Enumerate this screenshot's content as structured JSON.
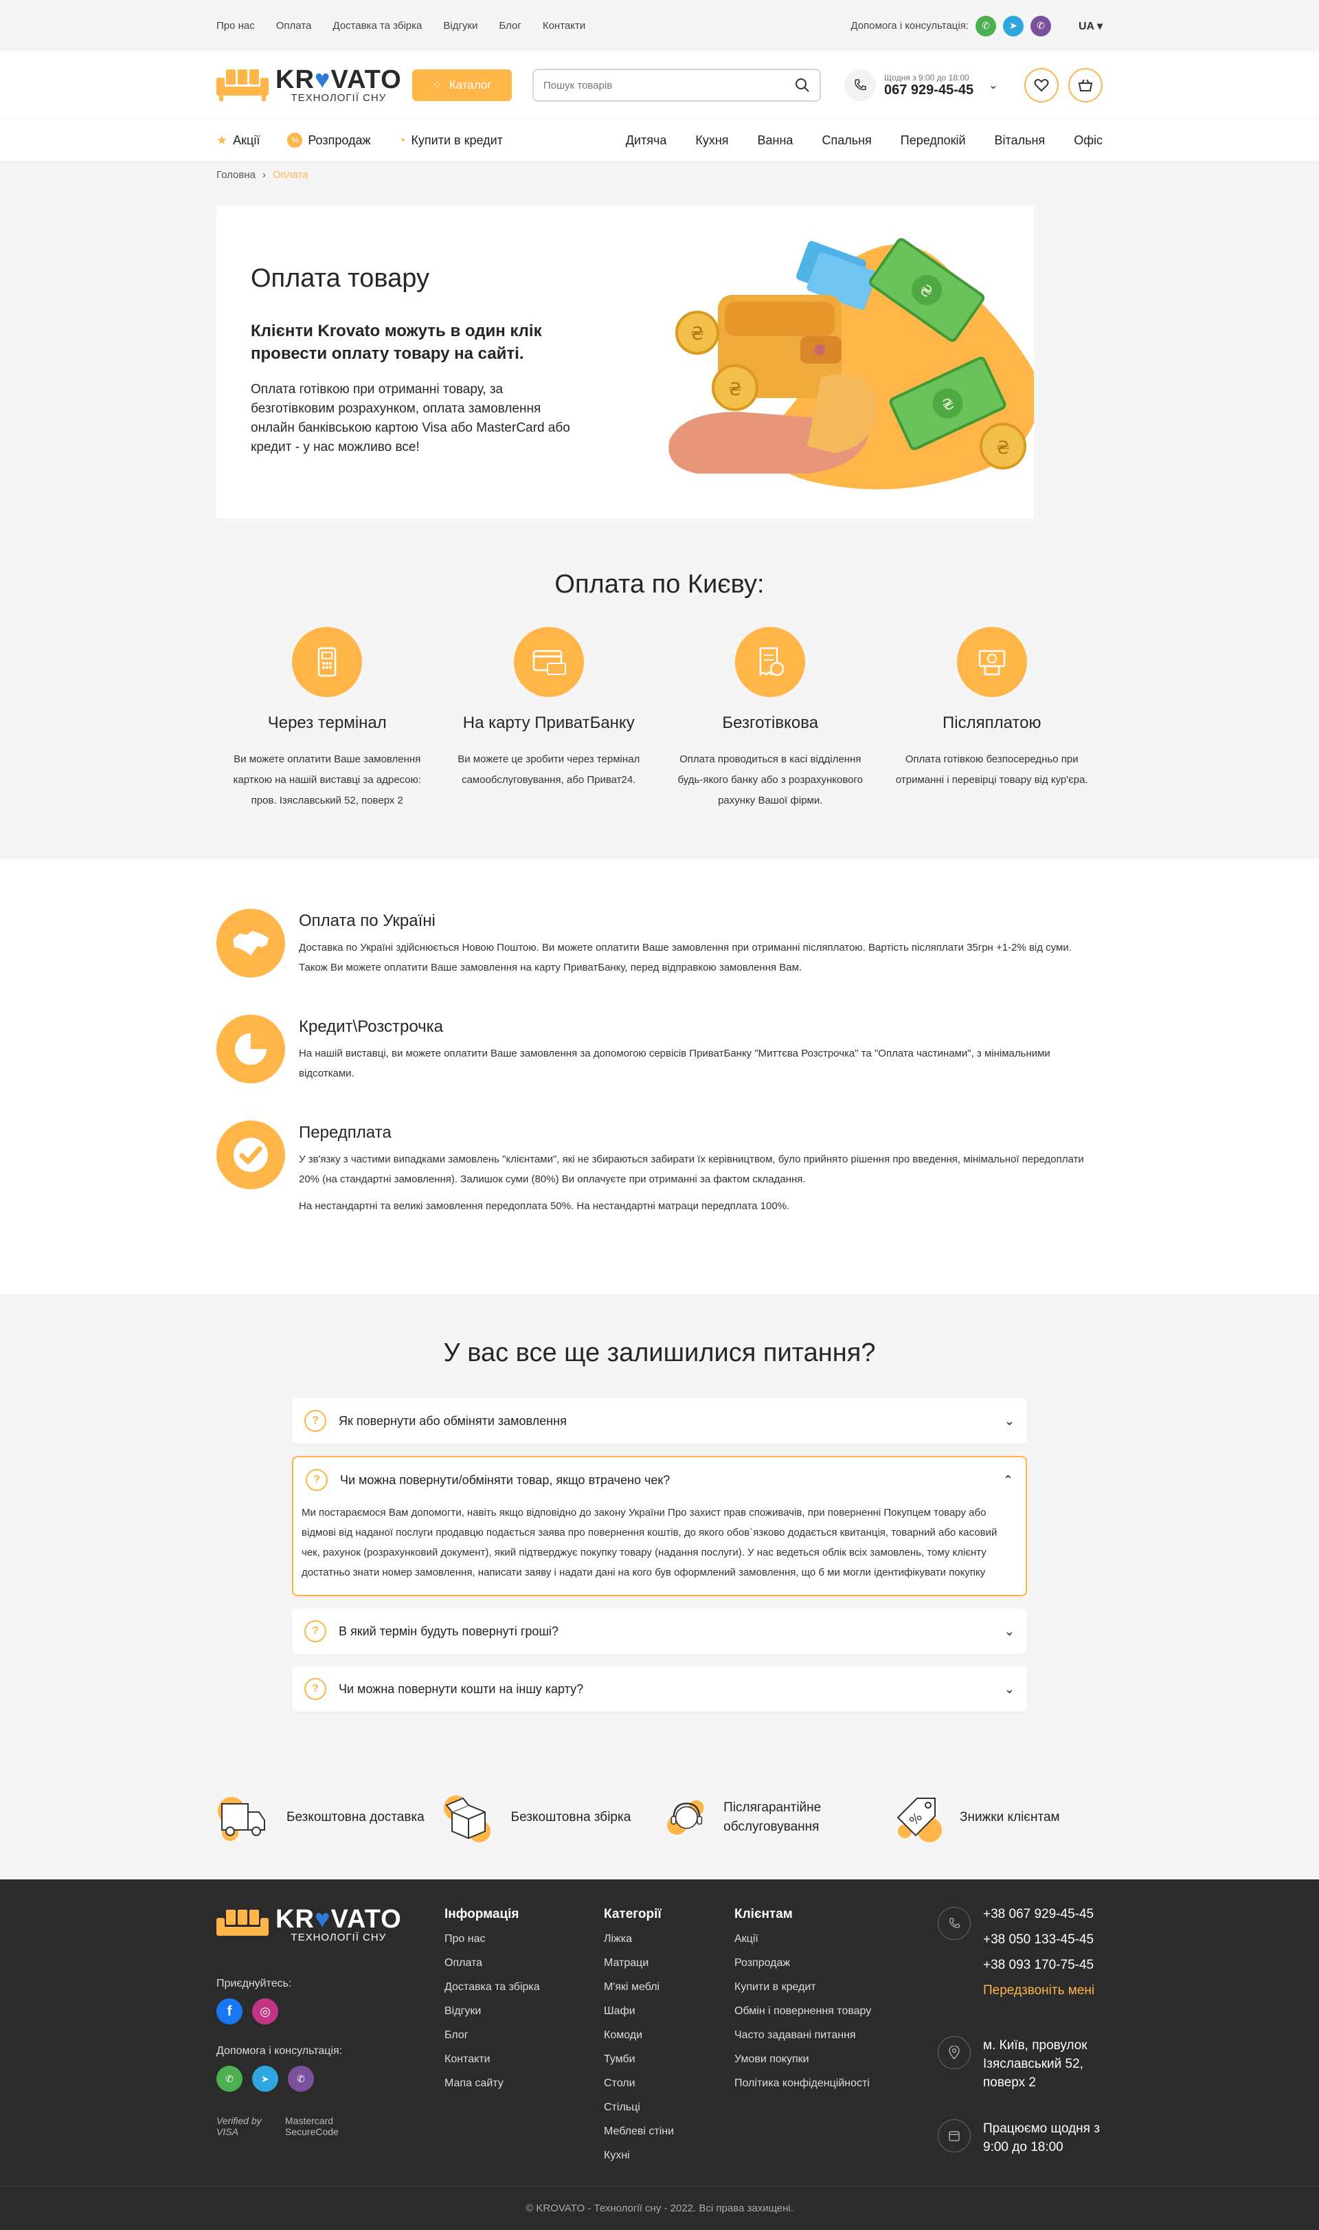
{
  "topbar": {
    "links": [
      "Про нас",
      "Оплата",
      "Доставка та збірка",
      "Відгуки",
      "Блог",
      "Контакти"
    ],
    "help_label": "Допомога і консультація:",
    "lang": "UA"
  },
  "header": {
    "brand": "KRVATO",
    "brand_o": "O",
    "slogan": "ТЕХНОЛОГІЇ СНУ",
    "catalog_label": "Каталог",
    "search_placeholder": "Пошук товарів",
    "hours": "Щодня з 9:00 до 18:00",
    "phone": "067 929-45-45"
  },
  "nav": {
    "left": [
      "Акції",
      "Розпродаж",
      "Купити в кредит"
    ],
    "right": [
      "Дитяча",
      "Кухня",
      "Ванна",
      "Спальня",
      "Передпокій",
      "Вітальня",
      "Офіс"
    ]
  },
  "breadcrumbs": {
    "home": "Головна",
    "current": "Оплата"
  },
  "hero": {
    "title": "Оплата товару",
    "subtitle": "Клієнти Krovato можуть в один клік провести оплату товару на сайті.",
    "text": "Оплата готівкою при отриманні товару, за безготівковим розрахунком, оплата замовлення онлайн банківською картою Visa або MasterCard або кредит - у нас можливо все!"
  },
  "kiev": {
    "title": "Оплата по Києву:",
    "items": [
      {
        "title": "Через термінал",
        "text": "Ви можете оплатити Ваше замовлення карткою на нашій виставці за адресою: пров. Ізяславський 52, поверх 2"
      },
      {
        "title": "На карту ПриватБанку",
        "text": "Ви можете це зробити через термінал самообслуговування, або Приват24."
      },
      {
        "title": "Безготівкова",
        "text": "Оплата проводиться в касі відділення будь-якого банку або з розрахункового рахунку Вашої фірми."
      },
      {
        "title": "Післяплатою",
        "text": "Оплата готівкою безпосередньо при отриманні і перевірці товару від кур'єра."
      }
    ]
  },
  "info": [
    {
      "title": "Оплата по Україні",
      "paragraphs": [
        "Доставка по Україні здійснюється Новою Поштою. Ви можете оплатити Ваше замовлення при отриманні післяплатою. Вартість післяплати 35грн +1-2% від суми. Також Ви можете оплатити Ваше замовлення на карту ПриватБанку, перед відправкою замовлення Вам."
      ]
    },
    {
      "title": "Кредит\\Розстрочка",
      "paragraphs": [
        "На нашій виставці, ви можете оплатити Ваше замовлення за допомогою сервісів ПриватБанку \"Миттєва Розстрочка\" та \"Оплата частинами\", з мінімальними відсотками."
      ]
    },
    {
      "title": "Передплата",
      "paragraphs": [
        "У зв'язку з частими випадками замовлень \"клієнтами\", які не збираються забирати їх керівництвом, було прийнято рішення про введення, мінімальної передоплати 20% (на стандартні замовлення). Залишок суми (80%) Ви оплачуєте при отриманні за фактом складання.",
        "На нестандартні та великі замовлення передоплата 50%. На нестандартні матраци передплата 100%."
      ]
    }
  ],
  "faq": {
    "title": "У вас все ще залишилися питання?",
    "items": [
      {
        "q": "Як повернути або обміняти замовлення",
        "a": "",
        "open": false
      },
      {
        "q": "Чи можна повернути/обміняти товар, якщо втрачено чек?",
        "a": "Ми постараємося Вам допомогти, навіть якщо відповідно до закону України Про захист прав споживачів, при поверненні Покупцем товару або відмові від наданої послуги продавцю подається заява про повернення коштів, до якого обов`язково додається квитанція, товарний або касовий чек, рахунок (розрахунковий документ), який підтверджує покупку товару (надання послуги). У нас ведеться облік всіх замовлень, тому клієнту достатньо знати номер замовлення, написати заяву і надати дані на кого був оформлений замовлення, що б ми могли ідентифікувати покупку",
        "open": true
      },
      {
        "q": "В який термін будуть повернуті гроші?",
        "a": "",
        "open": false
      },
      {
        "q": "Чи можна повернути кошти на іншу карту?",
        "a": "",
        "open": false
      }
    ]
  },
  "benefits": [
    "Безкоштовна доставка",
    "Безкоштовна збірка",
    "Післягарантійне обслуговування",
    "Знижки клієнтам"
  ],
  "footer": {
    "join_label": "Приєднуйтесь:",
    "help_label": "Допомога і консультація:",
    "verified": "Verified by VISA",
    "mastercard": "Mastercard SecureCode",
    "cols": [
      {
        "title": "Інформація",
        "items": [
          "Про нас",
          "Оплата",
          "Доставка та збірка",
          "Відгуки",
          "Блог",
          "Контакти",
          "Мапа сайту"
        ]
      },
      {
        "title": "Категорії",
        "items": [
          "Ліжка",
          "Матраци",
          "М'які меблі",
          "Шафи",
          "Комоди",
          "Тумби",
          "Столи",
          "Стільці",
          "Меблеві стіни",
          "Кухні"
        ]
      },
      {
        "title": "Клієнтам",
        "items": [
          "Акції",
          "Розпродаж",
          "Купити в кредит",
          "Обмін і повернення товару",
          "Часто задавані питання",
          "Умови покупки",
          "Політика конфіденційності"
        ]
      }
    ],
    "phones": [
      "+38 067 929-45-45",
      "+38 050 133-45-45",
      "+38 093 170-75-45"
    ],
    "callback": "Передзвоніть мені",
    "address": "м. Київ, провулок Ізяславський 52, поверх 2",
    "schedule": "Працюємо щодня з 9:00 до 18:00",
    "copyright": "© KROVATO - Технології сну - 2022. Всі права захищені."
  },
  "colors": {
    "accent": "#ffb548",
    "dark": "#2b2b2b",
    "bg": "#f5f5f5"
  }
}
